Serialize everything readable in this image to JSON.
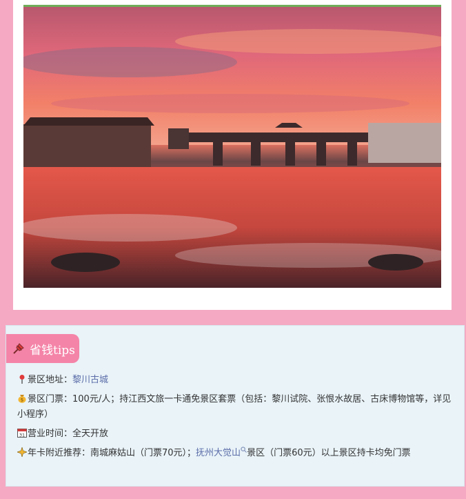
{
  "tips": {
    "badge": "省钱tips",
    "address_label": "景区地址：",
    "address_link": "黎川古城",
    "ticket_text": "景区门票：100元/人；持江西文旅一卡通免景区套票（包括：黎川试院、张恨水故居、古床博物馆等，详见小程序）",
    "hours_text": "营业时间：全天开放",
    "nearby_label": "年卡附近推荐：南城麻姑山（门票70元）；",
    "nearby_link": "抚州大觉山",
    "nearby_tail": "景区（门票60元）以上景区持卡均免门票"
  },
  "colors": {
    "page_bg": "#f5a9c2",
    "badge_bg": "#f484a8",
    "panel_bg": "#e9f3f8",
    "link": "#5b6ca8"
  },
  "icons": [
    "pushpin-icon",
    "round-pushpin-icon",
    "money-bag-icon",
    "calendar-icon",
    "sparkle-icon",
    "magnifier-icon"
  ]
}
